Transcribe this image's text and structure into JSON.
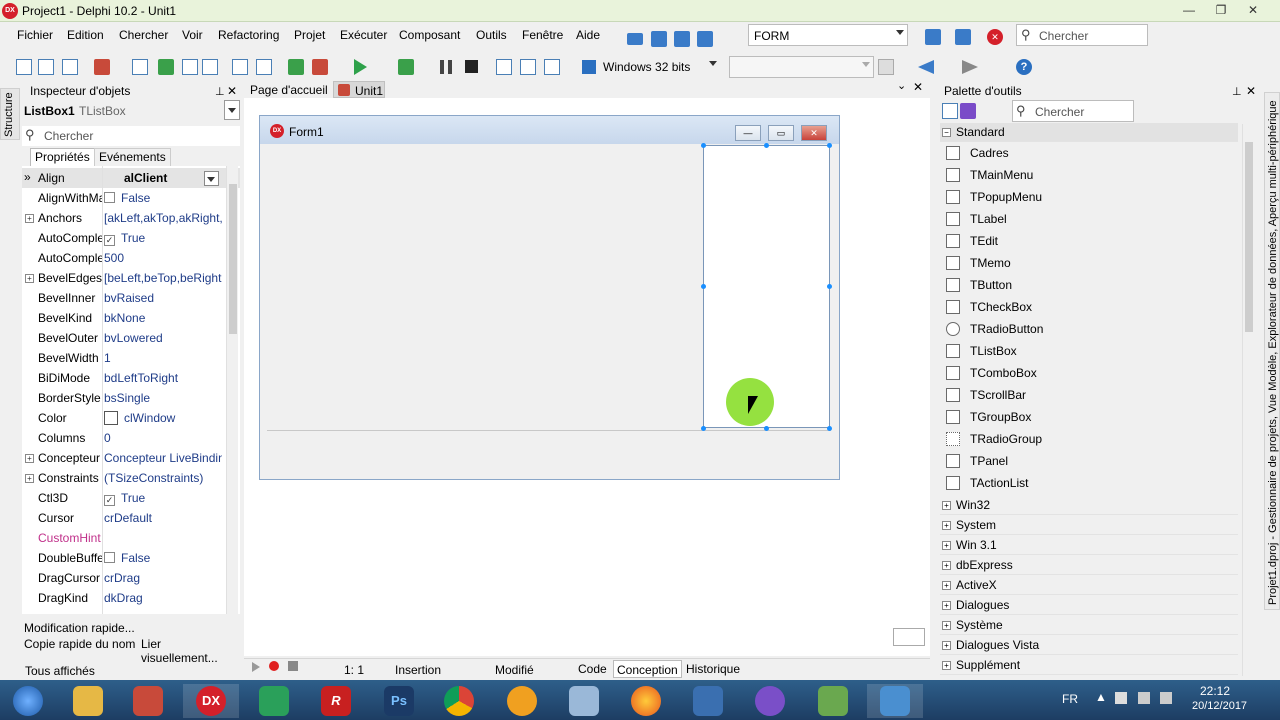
{
  "window": {
    "title": "Project1 - Delphi 10.2 - Unit1",
    "app_icon": "DX"
  },
  "menu": [
    "Fichier",
    "Edition",
    "Chercher",
    "Voir",
    "Refactoring",
    "Projet",
    "Exécuter",
    "Composant",
    "Outils",
    "Fenêtre",
    "Aide"
  ],
  "toolbar": {
    "layout_select": "FORM",
    "platform_select": "Windows 32 bits",
    "config_select": "",
    "search_placeholder": "Chercher"
  },
  "inspector": {
    "title": "Inspecteur d'objets",
    "component_name": "ListBox1",
    "component_type": "TListBox",
    "search_placeholder": "Chercher",
    "tab_properties": "Propriétés",
    "tab_events": "Evénements",
    "properties": [
      {
        "name": "Align",
        "value": "alClient"
      },
      {
        "name": "AlignWithMargins",
        "value": "False"
      },
      {
        "name": "Anchors",
        "value": "[akLeft,akTop,akRight,"
      },
      {
        "name": "AutoComplete",
        "value": "True"
      },
      {
        "name": "AutoCompleteDelay",
        "value": "500"
      },
      {
        "name": "BevelEdges",
        "value": "[beLeft,beTop,beRight"
      },
      {
        "name": "BevelInner",
        "value": "bvRaised"
      },
      {
        "name": "BevelKind",
        "value": "bkNone"
      },
      {
        "name": "BevelOuter",
        "value": "bvLowered"
      },
      {
        "name": "BevelWidth",
        "value": "1"
      },
      {
        "name": "BiDiMode",
        "value": "bdLeftToRight"
      },
      {
        "name": "BorderStyle",
        "value": "bsSingle"
      },
      {
        "name": "Color",
        "value": "clWindow"
      },
      {
        "name": "Columns",
        "value": "0"
      },
      {
        "name": "Concepteur",
        "value": "Concepteur LiveBindings"
      },
      {
        "name": "Constraints",
        "value": "(TSizeConstraints)"
      },
      {
        "name": "Ctl3D",
        "value": "True"
      },
      {
        "name": "Cursor",
        "value": "crDefault"
      },
      {
        "name": "CustomHint",
        "value": ""
      },
      {
        "name": "DoubleBuffered",
        "value": "False"
      },
      {
        "name": "DragCursor",
        "value": "crDrag"
      },
      {
        "name": "DragKind",
        "value": "dkDrag"
      }
    ],
    "quick_edit": "Modification rapide...",
    "copy_name": "Copie rapide du nom",
    "bind_visual": "Lier visuellement...",
    "all_shown": "Tous affichés"
  },
  "editor": {
    "tab_home": "Page d'accueil",
    "tab_unit": "Unit1",
    "form_caption": "Form1",
    "form_icon": "DX",
    "status_pos": "1:   1",
    "status_mode": "Insertion",
    "status_modified": "Modifié",
    "view_tabs": [
      "Code",
      "Conception",
      "Historique"
    ]
  },
  "palette": {
    "title": "Palette d'outils",
    "search_placeholder": "Chercher",
    "category_open": "Standard",
    "items": [
      "Cadres",
      "TMainMenu",
      "TPopupMenu",
      "TLabel",
      "TEdit",
      "TMemo",
      "TButton",
      "TCheckBox",
      "TRadioButton",
      "TListBox",
      "TComboBox",
      "TScrollBar",
      "TGroupBox",
      "TRadioGroup",
      "TPanel",
      "TActionList"
    ],
    "categories": [
      "Win32",
      "System",
      "Win 3.1",
      "dbExpress",
      "ActiveX",
      "Dialogues",
      "Système",
      "Dialogues Vista",
      "Supplément"
    ]
  },
  "side_tab": "Projet1.dproj - Gestionnaire de projets, Vue Modèle, Explorateur de données, Aperçu multi-périphérique",
  "structure_tab": "Structure",
  "taskbar": {
    "lang": "FR",
    "time": "22:12",
    "date": "20/12/2017",
    "dx_label": "DX",
    "ps_label": "Ps"
  },
  "colors": {
    "titlebar": "#e9f3db",
    "accent": "#1a8fff",
    "taskbar": "#1d3d63"
  }
}
